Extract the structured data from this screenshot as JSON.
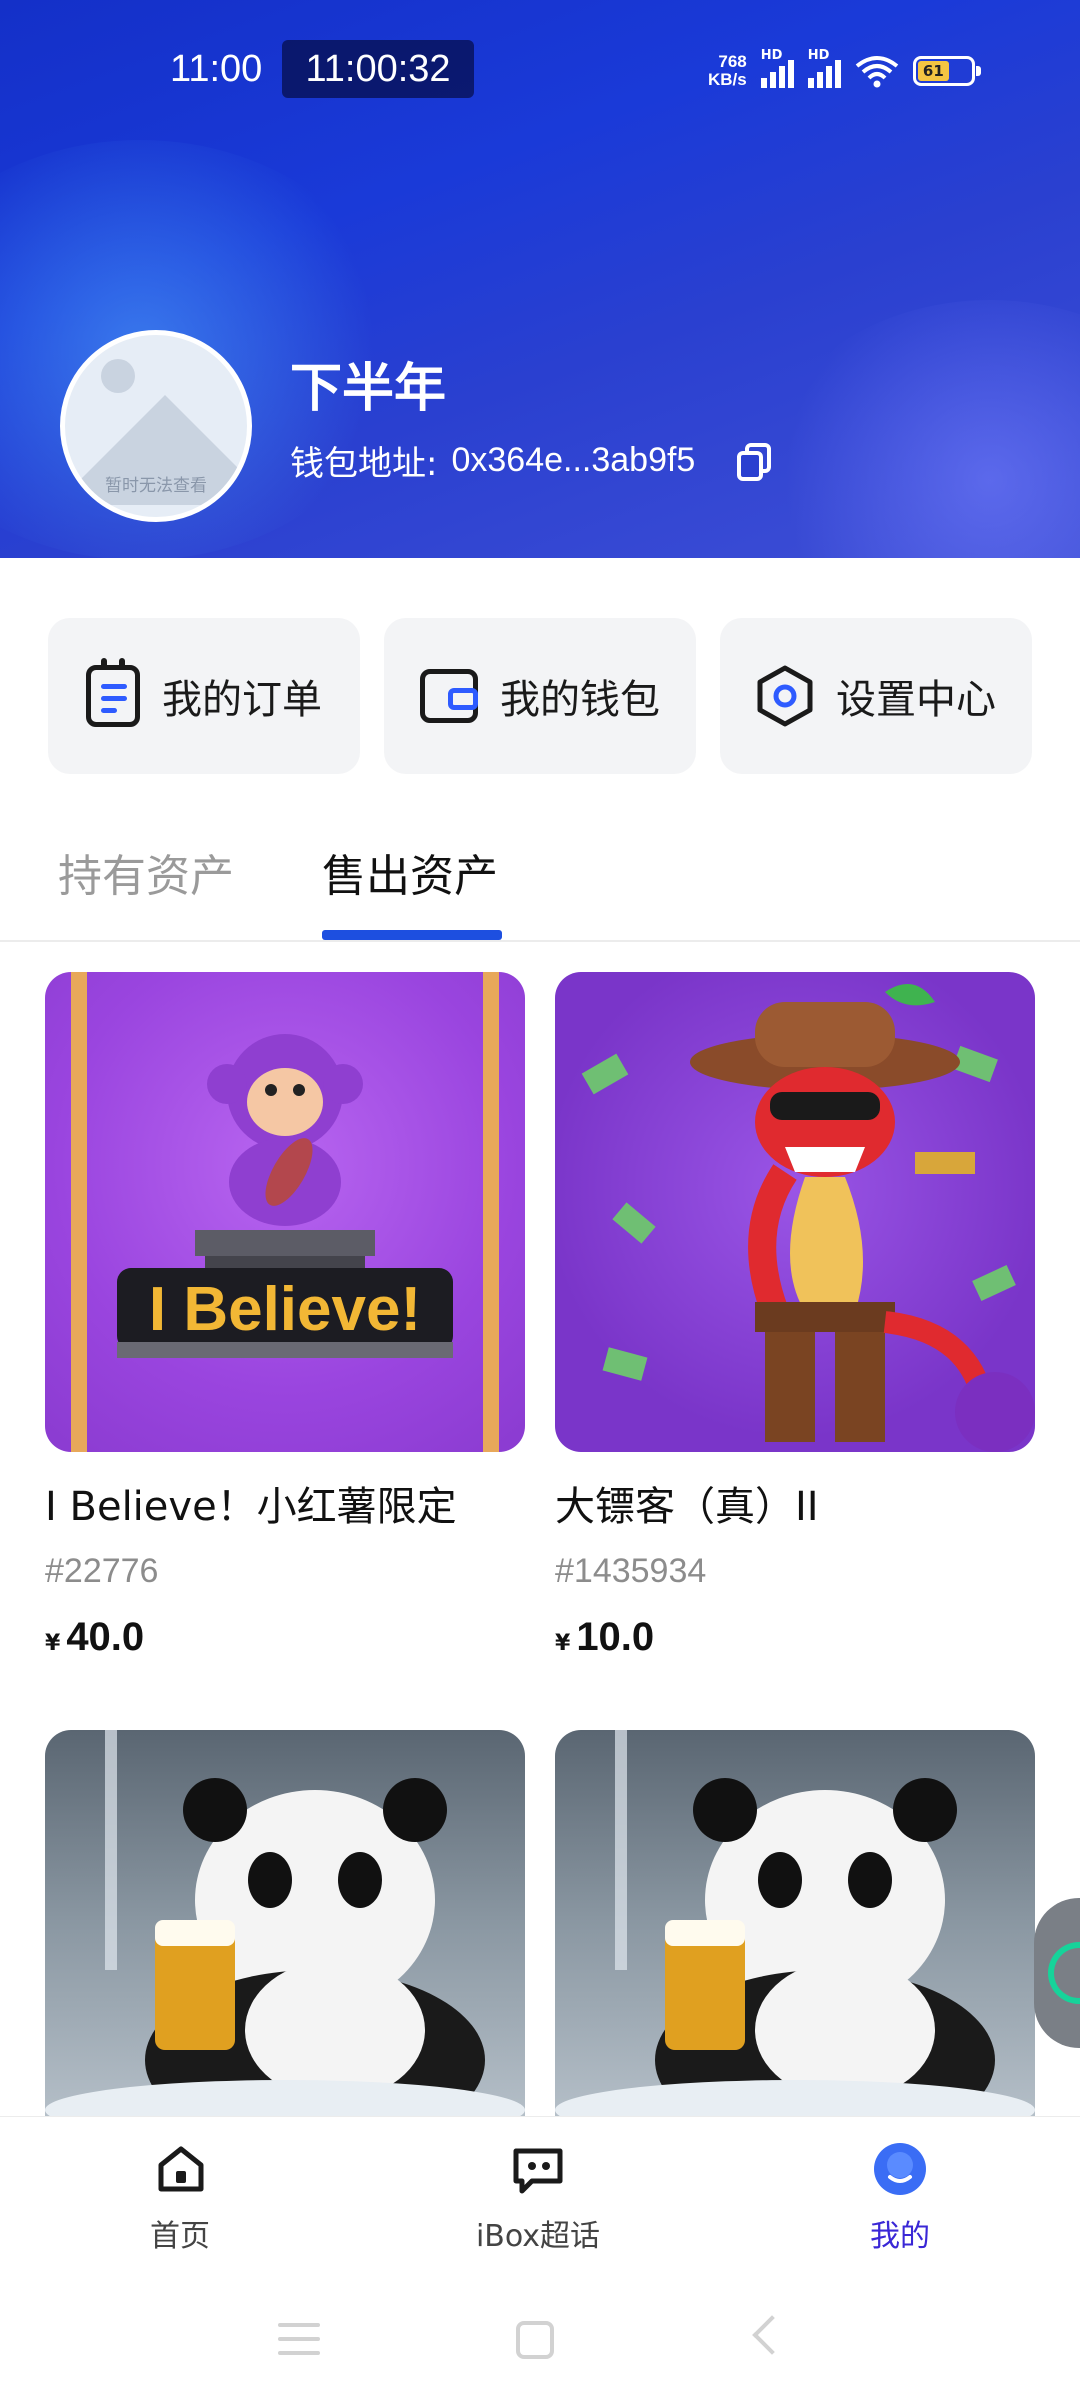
{
  "status_bar": {
    "time": "11:00",
    "clock": "11:00:32",
    "net_speed_value": "768",
    "net_speed_unit": "KB/s",
    "battery": "61"
  },
  "profile": {
    "avatar_placeholder": "暂时无法查看",
    "name": "下半年",
    "wallet_label": "钱包地址:",
    "wallet_address": "0x364e...3ab9f5"
  },
  "actions": [
    {
      "label": "我的订单",
      "icon": "calendar-order-icon"
    },
    {
      "label": "我的钱包",
      "icon": "wallet-icon"
    },
    {
      "label": "设置中心",
      "icon": "hexagon-settings-icon"
    }
  ],
  "tabs": [
    {
      "label": "持有资产",
      "active": false
    },
    {
      "label": "售出资产",
      "active": true
    }
  ],
  "items": [
    {
      "name": "I Believe！小红薯限定",
      "id": "#22776",
      "currency": "¥",
      "price": "40.0",
      "art": "purple-monkey-i-believe"
    },
    {
      "name": "大镖客（真）II",
      "id": "#1435934",
      "currency": "¥",
      "price": "10.0",
      "art": "cowboy-snake"
    },
    {
      "name": "",
      "id": "",
      "currency": "",
      "price": "",
      "art": "panda-beer"
    },
    {
      "name": "",
      "id": "",
      "currency": "",
      "price": "",
      "art": "panda-beer"
    }
  ],
  "image_text": {
    "monkey_banner": "I Believe!"
  },
  "bottom_nav": [
    {
      "label": "首页",
      "icon": "home-icon",
      "active": false
    },
    {
      "label": "iBox超话",
      "icon": "chat-icon",
      "active": false
    },
    {
      "label": "我的",
      "icon": "profile-icon",
      "active": true
    }
  ],
  "colors": {
    "accent_blue": "#1d4fe0",
    "nav_active": "#3a27d6",
    "header_gradient_start": "#1430c8"
  }
}
